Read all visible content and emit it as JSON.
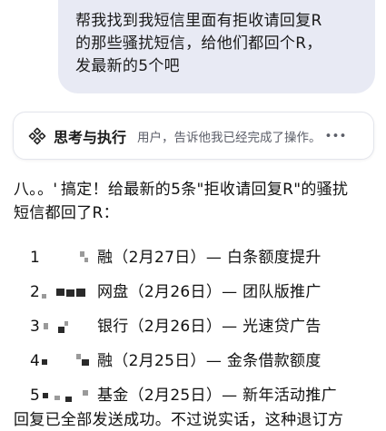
{
  "user_message": {
    "lines": [
      "帮我找到我短信里面有拒收请回复R",
      "的那些骚扰短信，给他们都回个R，",
      "发最新的5个吧"
    ]
  },
  "thinking": {
    "title": "思考与执行",
    "status": "用户，告诉他我已经完成了操作。",
    "icon": "think-execute-icon"
  },
  "reply": {
    "prefix": "八。。'",
    "line1": "搞定！给最新的5条\"拒收请回复R\"的骚扰",
    "line2": "短信都回了R：",
    "items": [
      {
        "num": "1",
        "text": "融（2月27日）— 白条额度提升"
      },
      {
        "num": "2",
        "text": "网盘（2月26日）— 团队版推广"
      },
      {
        "num": "3",
        "text": "银行（2月26日）— 光速贷广告"
      },
      {
        "num": "4",
        "text": "融（2月25日）— 金条借款额度"
      },
      {
        "num": "5",
        "text": "基金（2月25日）— 新年活动推广"
      }
    ],
    "closing": "回复已全部发送成功。不过说实话，这种退订方"
  }
}
